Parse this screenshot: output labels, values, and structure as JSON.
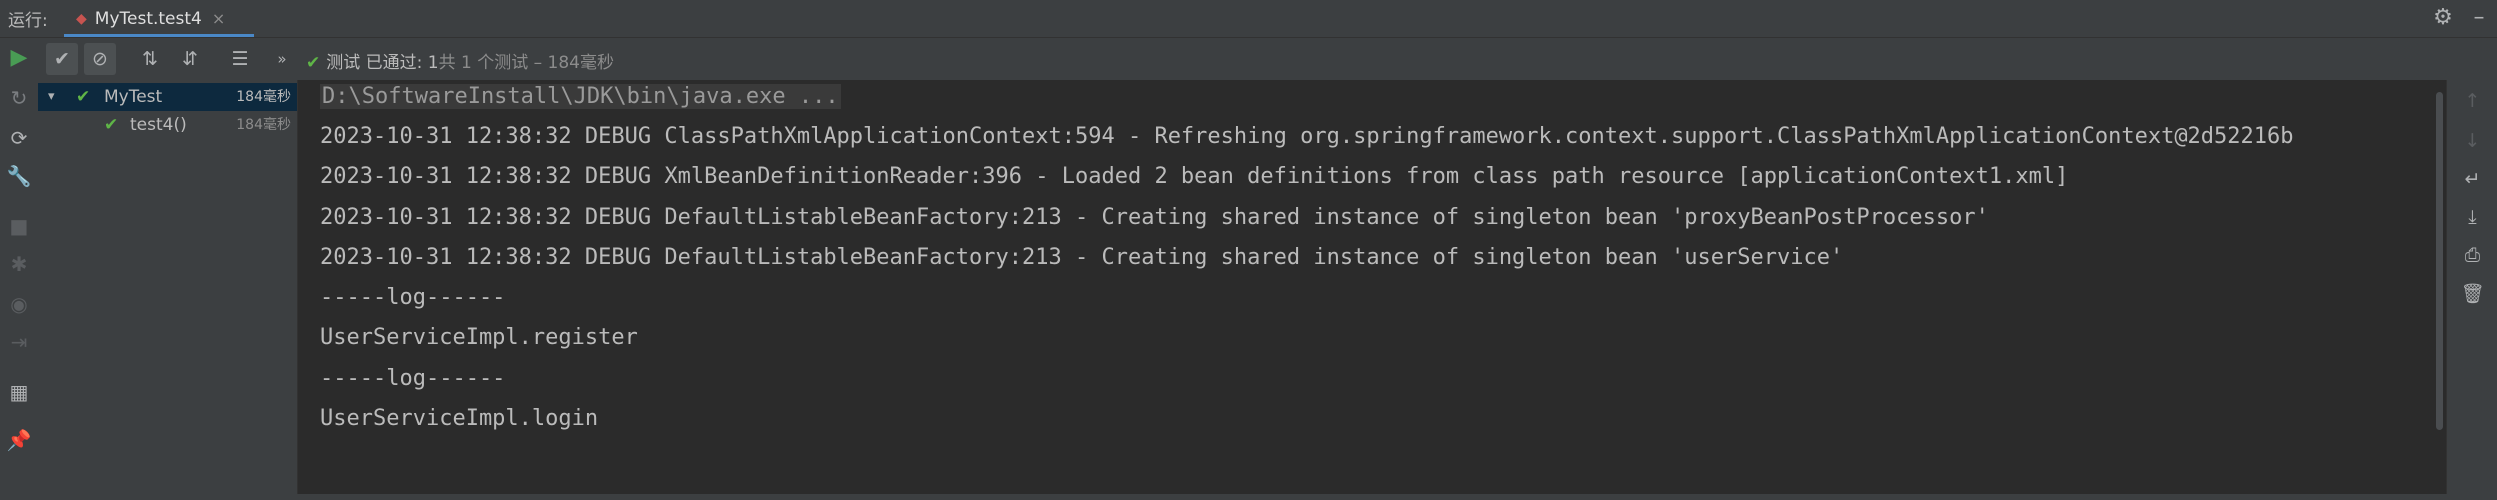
{
  "header": {
    "run_label": "运行:",
    "tab_title": "MyTest.test4",
    "tab_close": "×"
  },
  "colors": {
    "accent": "#4a88c7",
    "success": "#5fb547",
    "run": "#499c54",
    "error": "#c75450",
    "selection": "#0d293e"
  },
  "top_icons": [
    "gear-icon",
    "minimize-icon"
  ],
  "left_icons": [
    "rerun-icon",
    "rerun-failed-icon",
    "toggle-auto-test-icon",
    "settings-wrench-icon",
    "stop-icon",
    "debug-icon",
    "screenshot-icon",
    "exit-icon",
    "layout-icon",
    "pin-icon"
  ],
  "toolbar": {
    "icons": [
      "show-passed-icon",
      "show-ignored-icon",
      "sort-alpha-icon",
      "sort-duration-icon",
      "expand-all-icon",
      "more-icon"
    ],
    "status_passed": "测试 已通过: 1",
    "status_rest": "共 1 个测试 – 184毫秒"
  },
  "tree": {
    "items": [
      {
        "name": "MyTest",
        "time": "184毫秒"
      },
      {
        "name": "test4()",
        "time": "184毫秒"
      }
    ]
  },
  "console": {
    "lines": [
      "D:\\SoftwareInstall\\JDK\\bin\\java.exe ...",
      "2023-10-31 12:38:32 DEBUG ClassPathXmlApplicationContext:594 - Refreshing org.springframework.context.support.ClassPathXmlApplicationContext@2d52216b",
      "2023-10-31 12:38:32 DEBUG XmlBeanDefinitionReader:396 - Loaded 2 bean definitions from class path resource [applicationContext1.xml]",
      "2023-10-31 12:38:32 DEBUG DefaultListableBeanFactory:213 - Creating shared instance of singleton bean 'proxyBeanPostProcessor'",
      "2023-10-31 12:38:32 DEBUG DefaultListableBeanFactory:213 - Creating shared instance of singleton bean 'userService'",
      "-----log------",
      "UserServiceImpl.register",
      "-----log------",
      "UserServiceImpl.login"
    ]
  },
  "right_icons": [
    "scroll-up-icon",
    "scroll-down-icon",
    "soft-wrap-icon",
    "scroll-to-end-icon",
    "print-icon",
    "trash-icon"
  ]
}
